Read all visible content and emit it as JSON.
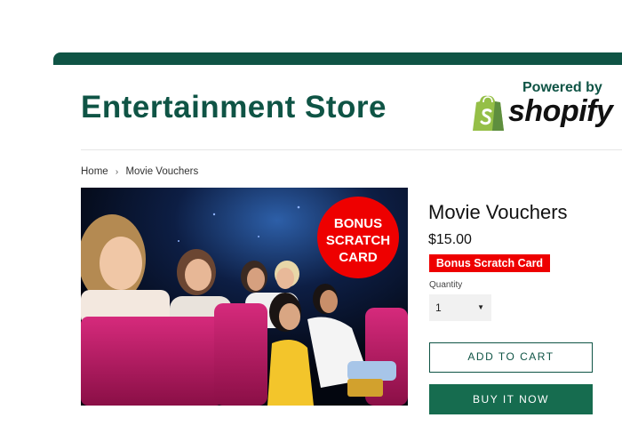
{
  "header": {
    "store_title": "Entertainment Store",
    "powered_by": "Powered by",
    "shopify_wordmark": "shopify"
  },
  "breadcrumb": {
    "home": "Home",
    "separator": "›",
    "current": "Movie Vouchers"
  },
  "product": {
    "image_badge": [
      "BONUS",
      "SCRATCH",
      "CARD"
    ],
    "title": "Movie Vouchers",
    "price": "$15.00",
    "promo_badge": "Bonus Scratch Card",
    "quantity_label": "Quantity",
    "quantity_value": "1",
    "add_to_cart_label": "ADD TO CART",
    "buy_now_label": "BUY IT NOW"
  },
  "colors": {
    "brand_green": "#0f5445",
    "buy_now_green": "#166c4f",
    "promo_red": "#ee0000",
    "shopify_green": "#95bf47"
  },
  "icons": {
    "shopify_logo": "shopify-bag-icon",
    "quantity_caret": "caret-down-icon",
    "breadcrumb_separator": "chevron-right-icon"
  }
}
